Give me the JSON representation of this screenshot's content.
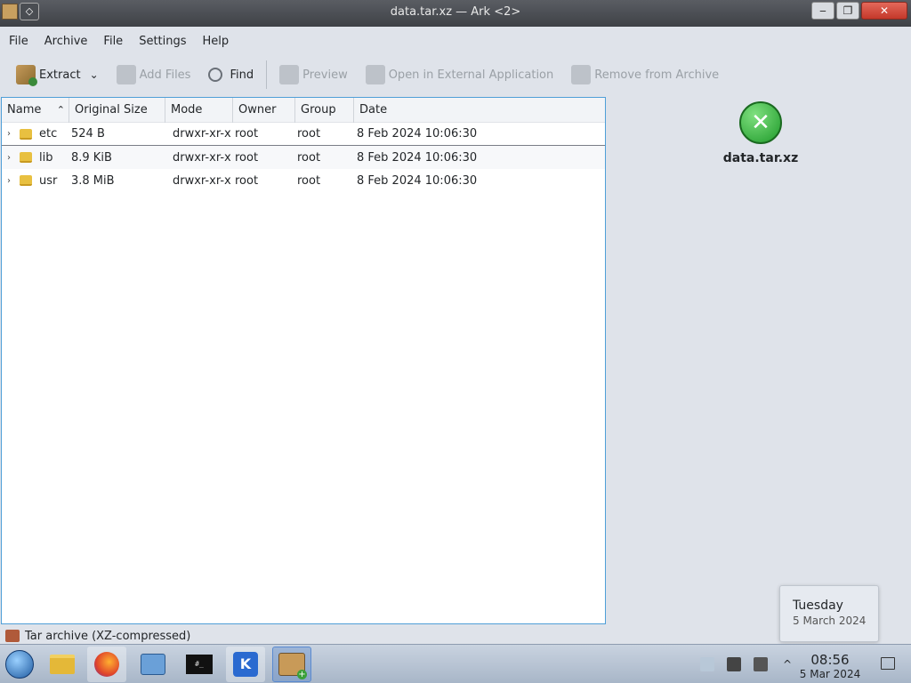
{
  "window": {
    "title": "data.tar.xz — Ark <2>",
    "menu_button": "◇",
    "minimize": "‒",
    "maximize": "❐",
    "close": "✕"
  },
  "menubar": [
    "File",
    "Archive",
    "File",
    "Settings",
    "Help"
  ],
  "toolbar": {
    "extract": "Extract",
    "add_files": "Add Files",
    "find": "Find",
    "preview": "Preview",
    "open_external": "Open in External Application",
    "remove": "Remove from Archive"
  },
  "filelist": {
    "columns": [
      "Name",
      "Original Size",
      "Mode",
      "Owner",
      "Group",
      "Date"
    ],
    "rows": [
      {
        "name": "etc",
        "size": "524 B",
        "mode": "drwxr-xr-x",
        "owner": "root",
        "group": "root",
        "date": "8 Feb 2024 10:06:30"
      },
      {
        "name": "lib",
        "size": "8.9 KiB",
        "mode": "drwxr-xr-x",
        "owner": "root",
        "group": "root",
        "date": "8 Feb 2024 10:06:30"
      },
      {
        "name": "usr",
        "size": "3.8 MiB",
        "mode": "drwxr-xr-x",
        "owner": "root",
        "group": "root",
        "date": "8 Feb 2024 10:06:30"
      }
    ]
  },
  "info_panel": {
    "filename": "data.tar.xz"
  },
  "status": {
    "text": "Tar archive (XZ-compressed)"
  },
  "date_popup": {
    "day": "Tuesday",
    "date": "5 March 2024"
  },
  "taskbar": {
    "terminal_text": "#_",
    "kde_text": "K",
    "clock_time": "08:56",
    "clock_date": "5 Mar 2024"
  }
}
